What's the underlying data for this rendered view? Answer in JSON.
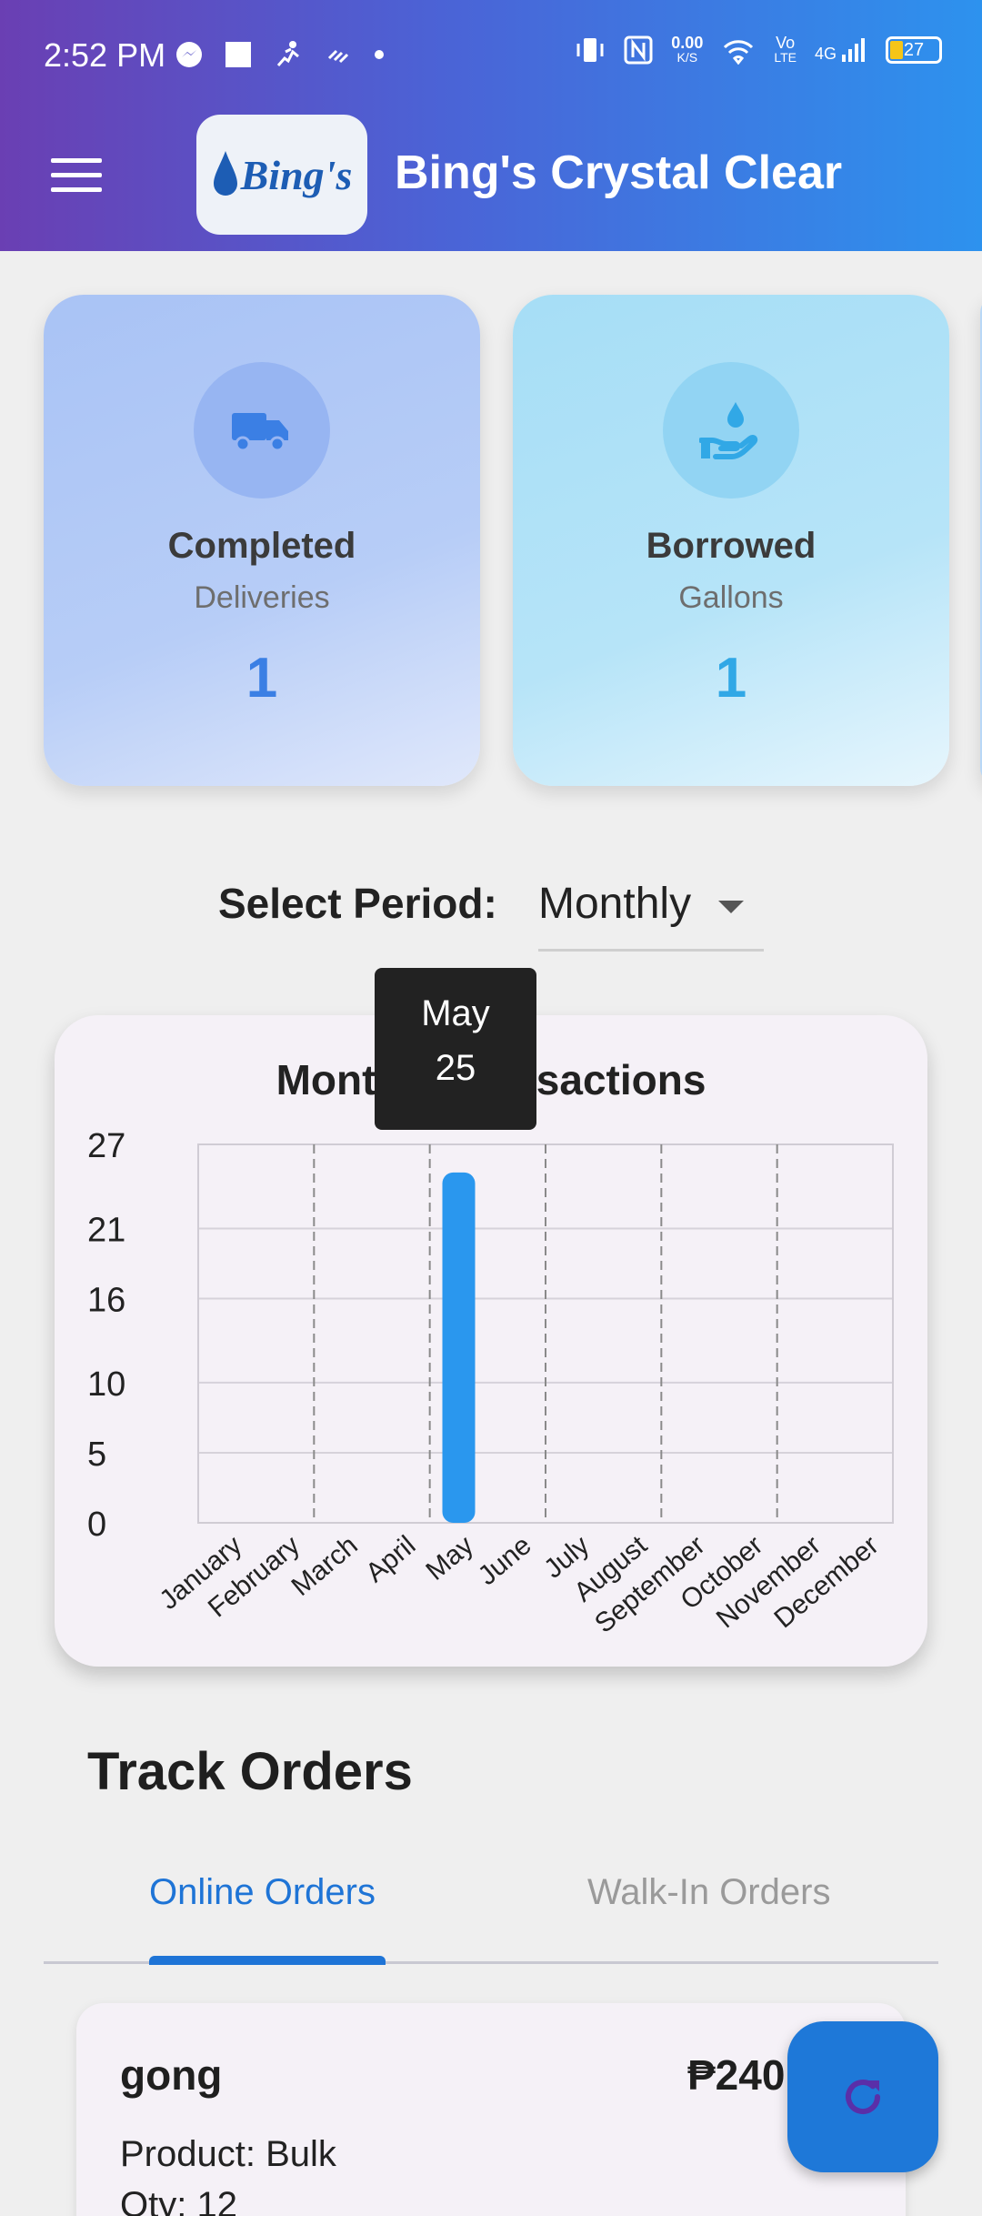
{
  "status_bar": {
    "time": "2:52 PM",
    "network_speed": "0.00",
    "network_unit": "K/S",
    "volte_top": "Vo",
    "volte_bottom": "LTE",
    "signal_type": "4G",
    "battery": "27"
  },
  "header": {
    "logo_text": "Bing's",
    "title": "Bing's Crystal Clear"
  },
  "stats": [
    {
      "title": "Completed",
      "subtitle": "Deliveries",
      "value": "1",
      "icon": "truck-icon"
    },
    {
      "title": "Borrowed",
      "subtitle": "Gallons",
      "value": "1",
      "icon": "water-hand-icon"
    }
  ],
  "period": {
    "label": "Select Period:",
    "selected": "Monthly"
  },
  "tooltip": {
    "month": "May",
    "value": "25"
  },
  "chart_data": {
    "type": "bar",
    "title": "Monthly Transactions",
    "categories": [
      "January",
      "February",
      "March",
      "April",
      "May",
      "June",
      "July",
      "August",
      "September",
      "October",
      "November",
      "December"
    ],
    "values": [
      0,
      0,
      0,
      0,
      25,
      0,
      0,
      0,
      0,
      0,
      0,
      0
    ],
    "yticks": [
      "0",
      "5",
      "10",
      "16",
      "21",
      "27"
    ],
    "ylim": [
      0,
      27
    ],
    "bar_color": "#2a97ee",
    "grid": true
  },
  "orders": {
    "section_title": "Track Orders",
    "tabs": [
      "Online Orders",
      "Walk-In Orders"
    ],
    "items": [
      {
        "name": "gong",
        "price": "₱240",
        "product": "Product: Bulk",
        "qty": "Qty: 12"
      }
    ]
  },
  "colors": {
    "primary": "#1e74d6",
    "header_start": "#6a3fb3",
    "header_end": "#2d92ee"
  }
}
